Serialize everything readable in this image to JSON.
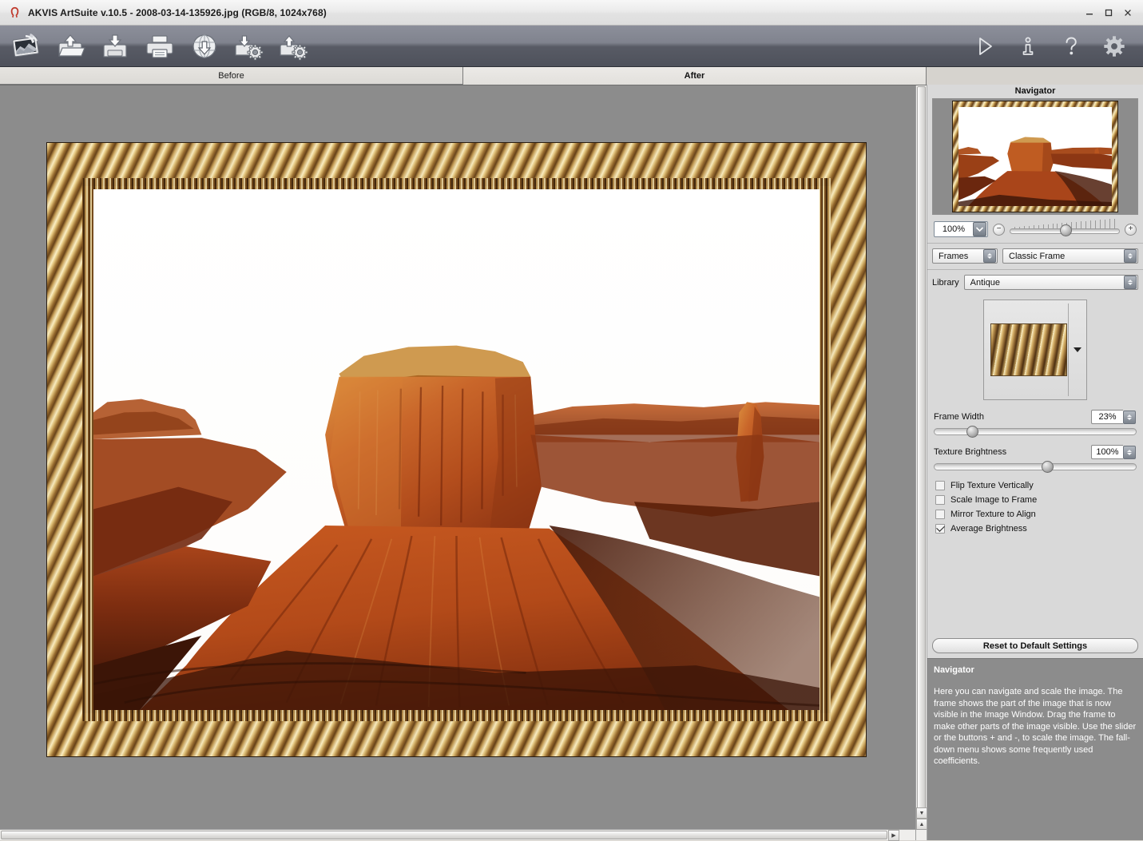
{
  "window": {
    "title": "AKVIS ArtSuite v.10.5 - 2008-03-14-135926.jpg (RGB/8, 1024x768)",
    "logo_icon": "akvis-horseshoe-logo",
    "minimize_label": "–",
    "maximize_label": "❐",
    "close_label": "✕"
  },
  "toolbar": {
    "left_items": [
      {
        "name": "app-photo-icon",
        "tip": "AKVIS ArtSuite"
      },
      {
        "name": "open-image-icon",
        "tip": "Open Image"
      },
      {
        "name": "save-image-icon",
        "tip": "Save Image"
      },
      {
        "name": "print-image-icon",
        "tip": "Print Image"
      },
      {
        "name": "download-from-server-icon",
        "tip": "Download"
      },
      {
        "name": "load-settings-icon",
        "tip": "Load Settings"
      },
      {
        "name": "save-settings-icon",
        "tip": "Save Settings"
      }
    ],
    "right_items": [
      {
        "name": "run-icon",
        "tip": "Run"
      },
      {
        "name": "info-icon",
        "tip": "Info"
      },
      {
        "name": "help-icon",
        "tip": "Help"
      },
      {
        "name": "preferences-gear-icon",
        "tip": "Preferences"
      }
    ]
  },
  "tabs": [
    {
      "label": "Before",
      "active": false
    },
    {
      "label": "After",
      "active": true
    }
  ],
  "navigator": {
    "title": "Navigator",
    "zoom_value": "100%",
    "zoom_dropdown_icon": "chevron-down-icon",
    "zoom_out_label": "−",
    "zoom_in_label": "+"
  },
  "frames": {
    "category_value": "Frames",
    "type_value": "Classic Frame",
    "library_label": "Library",
    "library_value": "Antique",
    "preview_dropdown_icon": "triangle-down-icon",
    "preview_swatch_name": "antique-frame-texture"
  },
  "sliders": [
    {
      "name": "Frame Width",
      "value": "23%",
      "pct": 16
    },
    {
      "name": "Texture Brightness",
      "value": "100%",
      "pct": 56
    }
  ],
  "checkboxes": [
    {
      "label": "Flip Texture Vertically",
      "checked": false
    },
    {
      "label": "Scale Image to Frame",
      "checked": false
    },
    {
      "label": "Mirror Texture to Align",
      "checked": false
    },
    {
      "label": "Average Brightness",
      "checked": true
    }
  ],
  "reset_button": {
    "label": "Reset to Default Settings"
  },
  "hints": {
    "title": "Navigator",
    "text": "Here you can navigate and scale the image. The frame shows the part of the image that is now visible in the Image Window. Drag the frame to make other parts of the image visible. Use the slider or the buttons + and -, to scale the image. The fall-down menu shows some frequently used coefficients."
  },
  "image": {
    "description": "Monument Valley red sandstone butte at sunset under a white sky, inside an ornate gold antique picture frame",
    "frame_style": "Antique gold ornate",
    "colors": {
      "sky": "#ffffff",
      "rock_light": "#d4722f",
      "rock_mid": "#b84e1d",
      "rock_dark": "#6d2a10",
      "shadow": "#4a1c0c",
      "frame_gold": "#c9a868",
      "frame_dark": "#5a3a16"
    }
  }
}
